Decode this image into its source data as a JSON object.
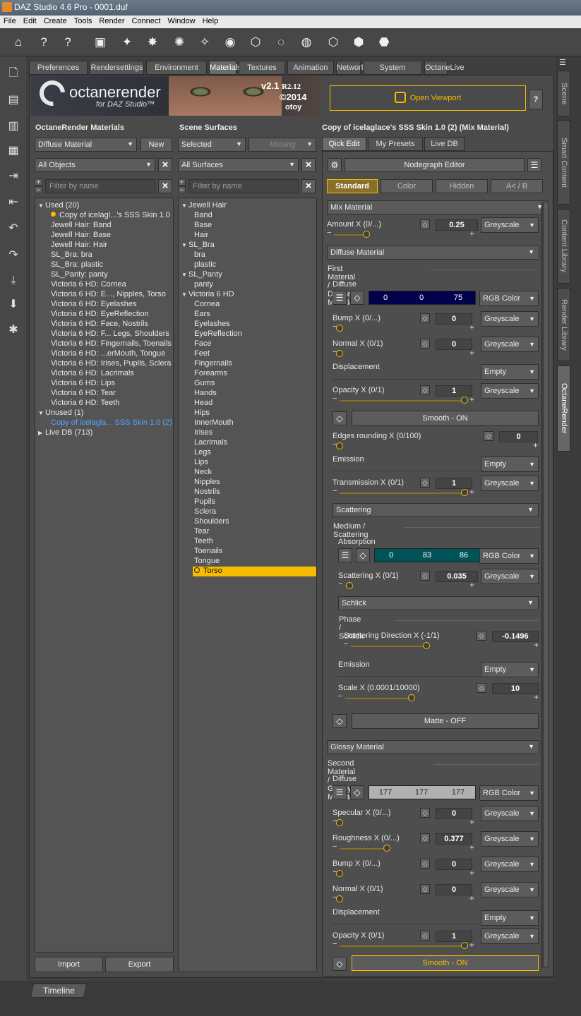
{
  "app": {
    "title": "DAZ Studio 4.6 Pro - 0001.duf"
  },
  "menu": [
    "File",
    "Edit",
    "Create",
    "Tools",
    "Render",
    "Connect",
    "Window",
    "Help"
  ],
  "tabs": [
    "Preferences",
    "Rendersettings",
    "Environment",
    "Materials",
    "Textures",
    "Animation",
    "Network",
    "System",
    "OctaneLive"
  ],
  "active_tab": "Materials",
  "banner": {
    "brand": "octanerender",
    "sub": "for DAZ Studio™",
    "version": "v2.1",
    "release": "R2.12",
    "copyright": "©2014",
    "otoy": "otoy"
  },
  "left": {
    "header": "OctaneRender Materials",
    "material_type": "Diffuse Material",
    "new_label": "New",
    "objects": "All Objects",
    "filter_placeholder": "Filter by name",
    "items": [
      {
        "t": "Used (20)",
        "lvl": 0,
        "tri": "▼"
      },
      {
        "t": "Copy of icelagl...'s SSS Skin 1.0",
        "lvl": 1,
        "dot": true
      },
      {
        "t": "Jewell Hair: Band",
        "lvl": 1
      },
      {
        "t": "Jewell Hair: Base",
        "lvl": 1
      },
      {
        "t": "Jewell Hair: Hair",
        "lvl": 1
      },
      {
        "t": "SL_Bra: bra",
        "lvl": 1
      },
      {
        "t": "SL_Bra: plastic",
        "lvl": 1
      },
      {
        "t": "SL_Panty: panty",
        "lvl": 1
      },
      {
        "t": "Victoria 6 HD: Cornea",
        "lvl": 1
      },
      {
        "t": "Victoria 6 HD: E..., Nipples, Torso",
        "lvl": 1
      },
      {
        "t": "Victoria 6 HD: Eyelashes",
        "lvl": 1
      },
      {
        "t": "Victoria 6 HD: EyeReflection",
        "lvl": 1
      },
      {
        "t": "Victoria 6 HD: Face, Nostrils",
        "lvl": 1
      },
      {
        "t": "Victoria 6 HD: F... Legs, Shoulders",
        "lvl": 1
      },
      {
        "t": "Victoria 6 HD: Fingernails, Toenails",
        "lvl": 1
      },
      {
        "t": "Victoria 6 HD: ...erMouth, Tongue",
        "lvl": 1
      },
      {
        "t": "Victoria 6 HD: Irises, Pupils, Sclera",
        "lvl": 1
      },
      {
        "t": "Victoria 6 HD: Lacrimals",
        "lvl": 1
      },
      {
        "t": "Victoria 6 HD: Lips",
        "lvl": 1
      },
      {
        "t": "Victoria 6 HD: Tear",
        "lvl": 1
      },
      {
        "t": "Victoria 6 HD: Teeth",
        "lvl": 1
      },
      {
        "t": "Unused (1)",
        "lvl": 0,
        "tri": "▼"
      },
      {
        "t": "Copy of icelagla... SSS Skin 1.0 (2)",
        "lvl": 1,
        "blue": true
      },
      {
        "t": "Live DB (713)",
        "lvl": 0,
        "tri": "▶"
      }
    ],
    "import_label": "Import",
    "export_label": "Export"
  },
  "middle": {
    "header": "Scene Surfaces",
    "mode": "Selected",
    "missing": "Missing",
    "surfaces": "All Surfaces",
    "filter_placeholder": "Filter by name",
    "items": [
      {
        "t": "Jewell Hair",
        "lvl": 0,
        "tri": "▼"
      },
      {
        "t": "Band",
        "lvl": 1
      },
      {
        "t": "Base",
        "lvl": 1
      },
      {
        "t": "Hair",
        "lvl": 1
      },
      {
        "t": "SL_Bra",
        "lvl": 0,
        "tri": "▼"
      },
      {
        "t": "bra",
        "lvl": 1
      },
      {
        "t": "plastic",
        "lvl": 1
      },
      {
        "t": "SL_Panty",
        "lvl": 0,
        "tri": "▼"
      },
      {
        "t": "panty",
        "lvl": 1
      },
      {
        "t": "Victoria 6 HD",
        "lvl": 0,
        "tri": "▼"
      },
      {
        "t": "Cornea",
        "lvl": 1
      },
      {
        "t": "Ears",
        "lvl": 1
      },
      {
        "t": "Eyelashes",
        "lvl": 1
      },
      {
        "t": "EyeReflection",
        "lvl": 1
      },
      {
        "t": "Face",
        "lvl": 1
      },
      {
        "t": "Feet",
        "lvl": 1
      },
      {
        "t": "Fingernails",
        "lvl": 1
      },
      {
        "t": "Forearms",
        "lvl": 1
      },
      {
        "t": "Gums",
        "lvl": 1
      },
      {
        "t": "Hands",
        "lvl": 1
      },
      {
        "t": "Head",
        "lvl": 1
      },
      {
        "t": "Hips",
        "lvl": 1
      },
      {
        "t": "InnerMouth",
        "lvl": 1
      },
      {
        "t": "Irises",
        "lvl": 1
      },
      {
        "t": "Lacrimals",
        "lvl": 1
      },
      {
        "t": "Legs",
        "lvl": 1
      },
      {
        "t": "Lips",
        "lvl": 1
      },
      {
        "t": "Neck",
        "lvl": 1
      },
      {
        "t": "Nipples",
        "lvl": 1
      },
      {
        "t": "Nostrils",
        "lvl": 1
      },
      {
        "t": "Pupils",
        "lvl": 1
      },
      {
        "t": "Sclera",
        "lvl": 1
      },
      {
        "t": "Shoulders",
        "lvl": 1
      },
      {
        "t": "Tear",
        "lvl": 1
      },
      {
        "t": "Teeth",
        "lvl": 1
      },
      {
        "t": "Toenails",
        "lvl": 1
      },
      {
        "t": "Tongue",
        "lvl": 1
      },
      {
        "t": "Torso",
        "lvl": 1,
        "sel": true
      }
    ]
  },
  "right": {
    "open_viewport": "Open Viewport",
    "help": "?",
    "title": "Copy of icelaglace's SSS Skin 1.0 (2)  (Mix Material)",
    "subtabs": [
      "Qick Edit",
      "My Presets",
      "Live DB"
    ],
    "nodegraph": "Nodegraph Editor",
    "modes": [
      "Standard",
      "Color",
      "Hidden",
      "A< / B"
    ],
    "mix": "Mix Material",
    "amount": {
      "label": "Amount X (0/...)",
      "value": "0.25",
      "level": 0.25,
      "type": "Greyscale"
    },
    "first_sel": "Diffuse Material",
    "first_title": "First Material / Diffuse Material",
    "diffuse": {
      "label": "Diffuse",
      "r": "0",
      "g": "0",
      "b": "75",
      "color": "#00004b",
      "type": "RGB Color"
    },
    "bump": {
      "label": "Bump X (0/...)",
      "value": "0",
      "type": "Greyscale"
    },
    "normal": {
      "label": "Normal X (0/1)",
      "value": "0",
      "type": "Greyscale"
    },
    "displacement": {
      "label": "Displacement",
      "type": "Empty"
    },
    "opacity": {
      "label": "Opacity X (0/1)",
      "value": "1",
      "type": "Greyscale"
    },
    "smooth": "Smooth - ON",
    "edges": {
      "label": "Edges rounding X (0/100)",
      "value": "0"
    },
    "emission": {
      "label": "Emission",
      "type": "Empty"
    },
    "transmission": {
      "label": "Transmission X (0/1)",
      "value": "1",
      "type": "Greyscale"
    },
    "scattering_sel": "Scattering",
    "medium_title": "Medium / Scattering",
    "absorption": {
      "label": "Absorption",
      "r": "0",
      "g": "83",
      "b": "86",
      "color": "#005356",
      "type": "RGB Color"
    },
    "scatter": {
      "label": "Scattering X (0/1)",
      "value": "0.035",
      "type": "Greyscale"
    },
    "schlick": "Schlick",
    "phase_title": "Phase / Schlick",
    "scat_dir": {
      "label": "Scattering Direction X (-1/1)",
      "value": "-0.1496"
    },
    "emission2": {
      "label": "Emission",
      "type": "Empty"
    },
    "scale": {
      "label": "Scale X (0.0001/10000)",
      "value": "10"
    },
    "matte": "Matte - OFF",
    "second_sel": "Glossy Material",
    "second_title": "Second Material / Glossy Material",
    "diffuse2": {
      "label": "Diffuse",
      "r": "177",
      "g": "177",
      "b": "177",
      "color": "#b1b1b1",
      "type": "RGB Color"
    },
    "specular": {
      "label": "Specular X (0/...)",
      "value": "0",
      "type": "Greyscale"
    },
    "roughness": {
      "label": "Roughness X (0/...)",
      "value": "0.377",
      "type": "Greyscale"
    },
    "bump2": {
      "label": "Bump X (0/...)",
      "value": "0",
      "type": "Greyscale"
    },
    "normal2": {
      "label": "Normal X (0/1)",
      "value": "0",
      "type": "Greyscale"
    },
    "displacement2": {
      "label": "Displacement",
      "type": "Empty"
    },
    "opacity2": {
      "label": "Opacity X (0/1)",
      "value": "1",
      "type": "Greyscale"
    },
    "smooth2": "Smooth - ON"
  },
  "side_tabs": [
    "Scene",
    "Smart Content",
    "Content Library",
    "Render Library",
    "OctaneRender"
  ],
  "timeline": "Timeline"
}
